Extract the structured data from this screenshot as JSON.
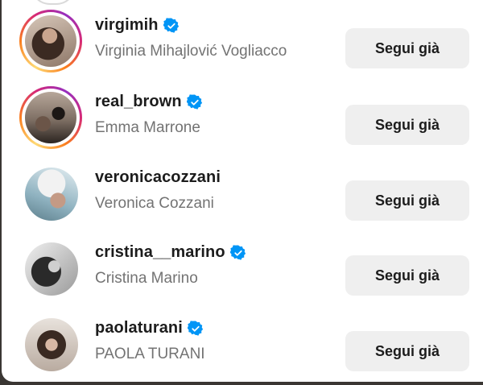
{
  "follow_list": [
    {
      "username": "virgimih",
      "full_name": "Virginia Mihajlović Vogliacco",
      "verified": true,
      "has_story": true,
      "button_label": "Segui già"
    },
    {
      "username": "real_brown",
      "full_name": "Emma Marrone",
      "verified": true,
      "has_story": true,
      "button_label": "Segui già"
    },
    {
      "username": "veronicacozzani",
      "full_name": "Veronica Cozzani",
      "verified": false,
      "has_story": false,
      "button_label": "Segui già"
    },
    {
      "username": "cristina__marino",
      "full_name": "Cristina Marino",
      "verified": true,
      "has_story": false,
      "button_label": "Segui già"
    },
    {
      "username": "paolaturani",
      "full_name": "PAOLA TURANI",
      "verified": true,
      "has_story": false,
      "button_label": "Segui già"
    }
  ],
  "colors": {
    "verified_badge": "#0095f6",
    "button_bg": "#efefef",
    "secondary_text": "#737373"
  }
}
